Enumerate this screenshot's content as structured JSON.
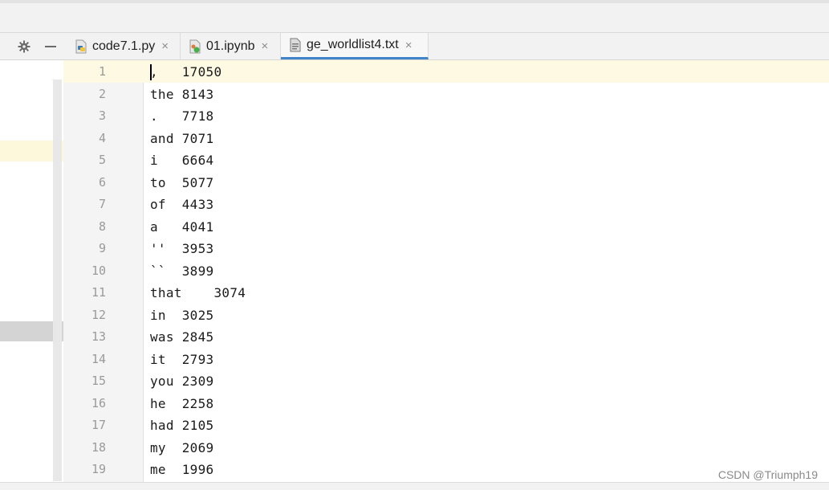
{
  "tabs": [
    {
      "label": "code7.1.py",
      "icon": "python-file-icon",
      "active": false
    },
    {
      "label": "01.ipynb",
      "icon": "notebook-file-icon",
      "active": false
    },
    {
      "label": "ge_worldlist4.txt",
      "icon": "text-file-icon",
      "active": true
    }
  ],
  "toolbar": {
    "settings_icon": "gear-icon",
    "minimize_icon": "minus-icon",
    "close_glyph": "×"
  },
  "lines": [
    {
      "num": "1",
      "text": ",   17050"
    },
    {
      "num": "2",
      "text": "the 8143"
    },
    {
      "num": "3",
      "text": ".   7718"
    },
    {
      "num": "4",
      "text": "and 7071"
    },
    {
      "num": "5",
      "text": "i   6664"
    },
    {
      "num": "6",
      "text": "to  5077"
    },
    {
      "num": "7",
      "text": "of  4433"
    },
    {
      "num": "8",
      "text": "a   4041"
    },
    {
      "num": "9",
      "text": "''  3953"
    },
    {
      "num": "10",
      "text": "``  3899"
    },
    {
      "num": "11",
      "text": "that    3074"
    },
    {
      "num": "12",
      "text": "in  3025"
    },
    {
      "num": "13",
      "text": "was 2845"
    },
    {
      "num": "14",
      "text": "it  2793"
    },
    {
      "num": "15",
      "text": "you 2309"
    },
    {
      "num": "16",
      "text": "he  2258"
    },
    {
      "num": "17",
      "text": "had 2105"
    },
    {
      "num": "18",
      "text": "my  2069"
    },
    {
      "num": "19",
      "text": "me  1996"
    }
  ],
  "watermark": "CSDN @Triumph19",
  "colors": {
    "current_line": "#fdf9e3",
    "active_tab_underline": "#4083c9"
  }
}
